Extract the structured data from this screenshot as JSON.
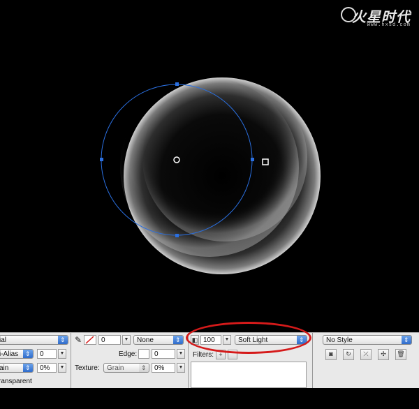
{
  "watermark": {
    "brand": "火星时代",
    "url": "www.hxsd.com"
  },
  "properties": {
    "text": {
      "font": "ial",
      "antialias": "i-Alias",
      "antialias_value": "0",
      "orientation": "ain",
      "orientation_value": "0%",
      "transparent_label": "ransparent"
    },
    "stroke": {
      "size": "0",
      "fill_option": "None",
      "edge_label": "Edge:",
      "edge_value": "0",
      "texture_label": "Texture:",
      "texture_value": "Grain",
      "texture_amount": "0%"
    },
    "blend": {
      "opacity": "100",
      "mode": "Soft Light",
      "filters_label": "Filters:"
    },
    "style": {
      "value": "No Style"
    }
  },
  "colors": {
    "selection": "#2a6fe0",
    "highlight": "#d51a1a"
  }
}
